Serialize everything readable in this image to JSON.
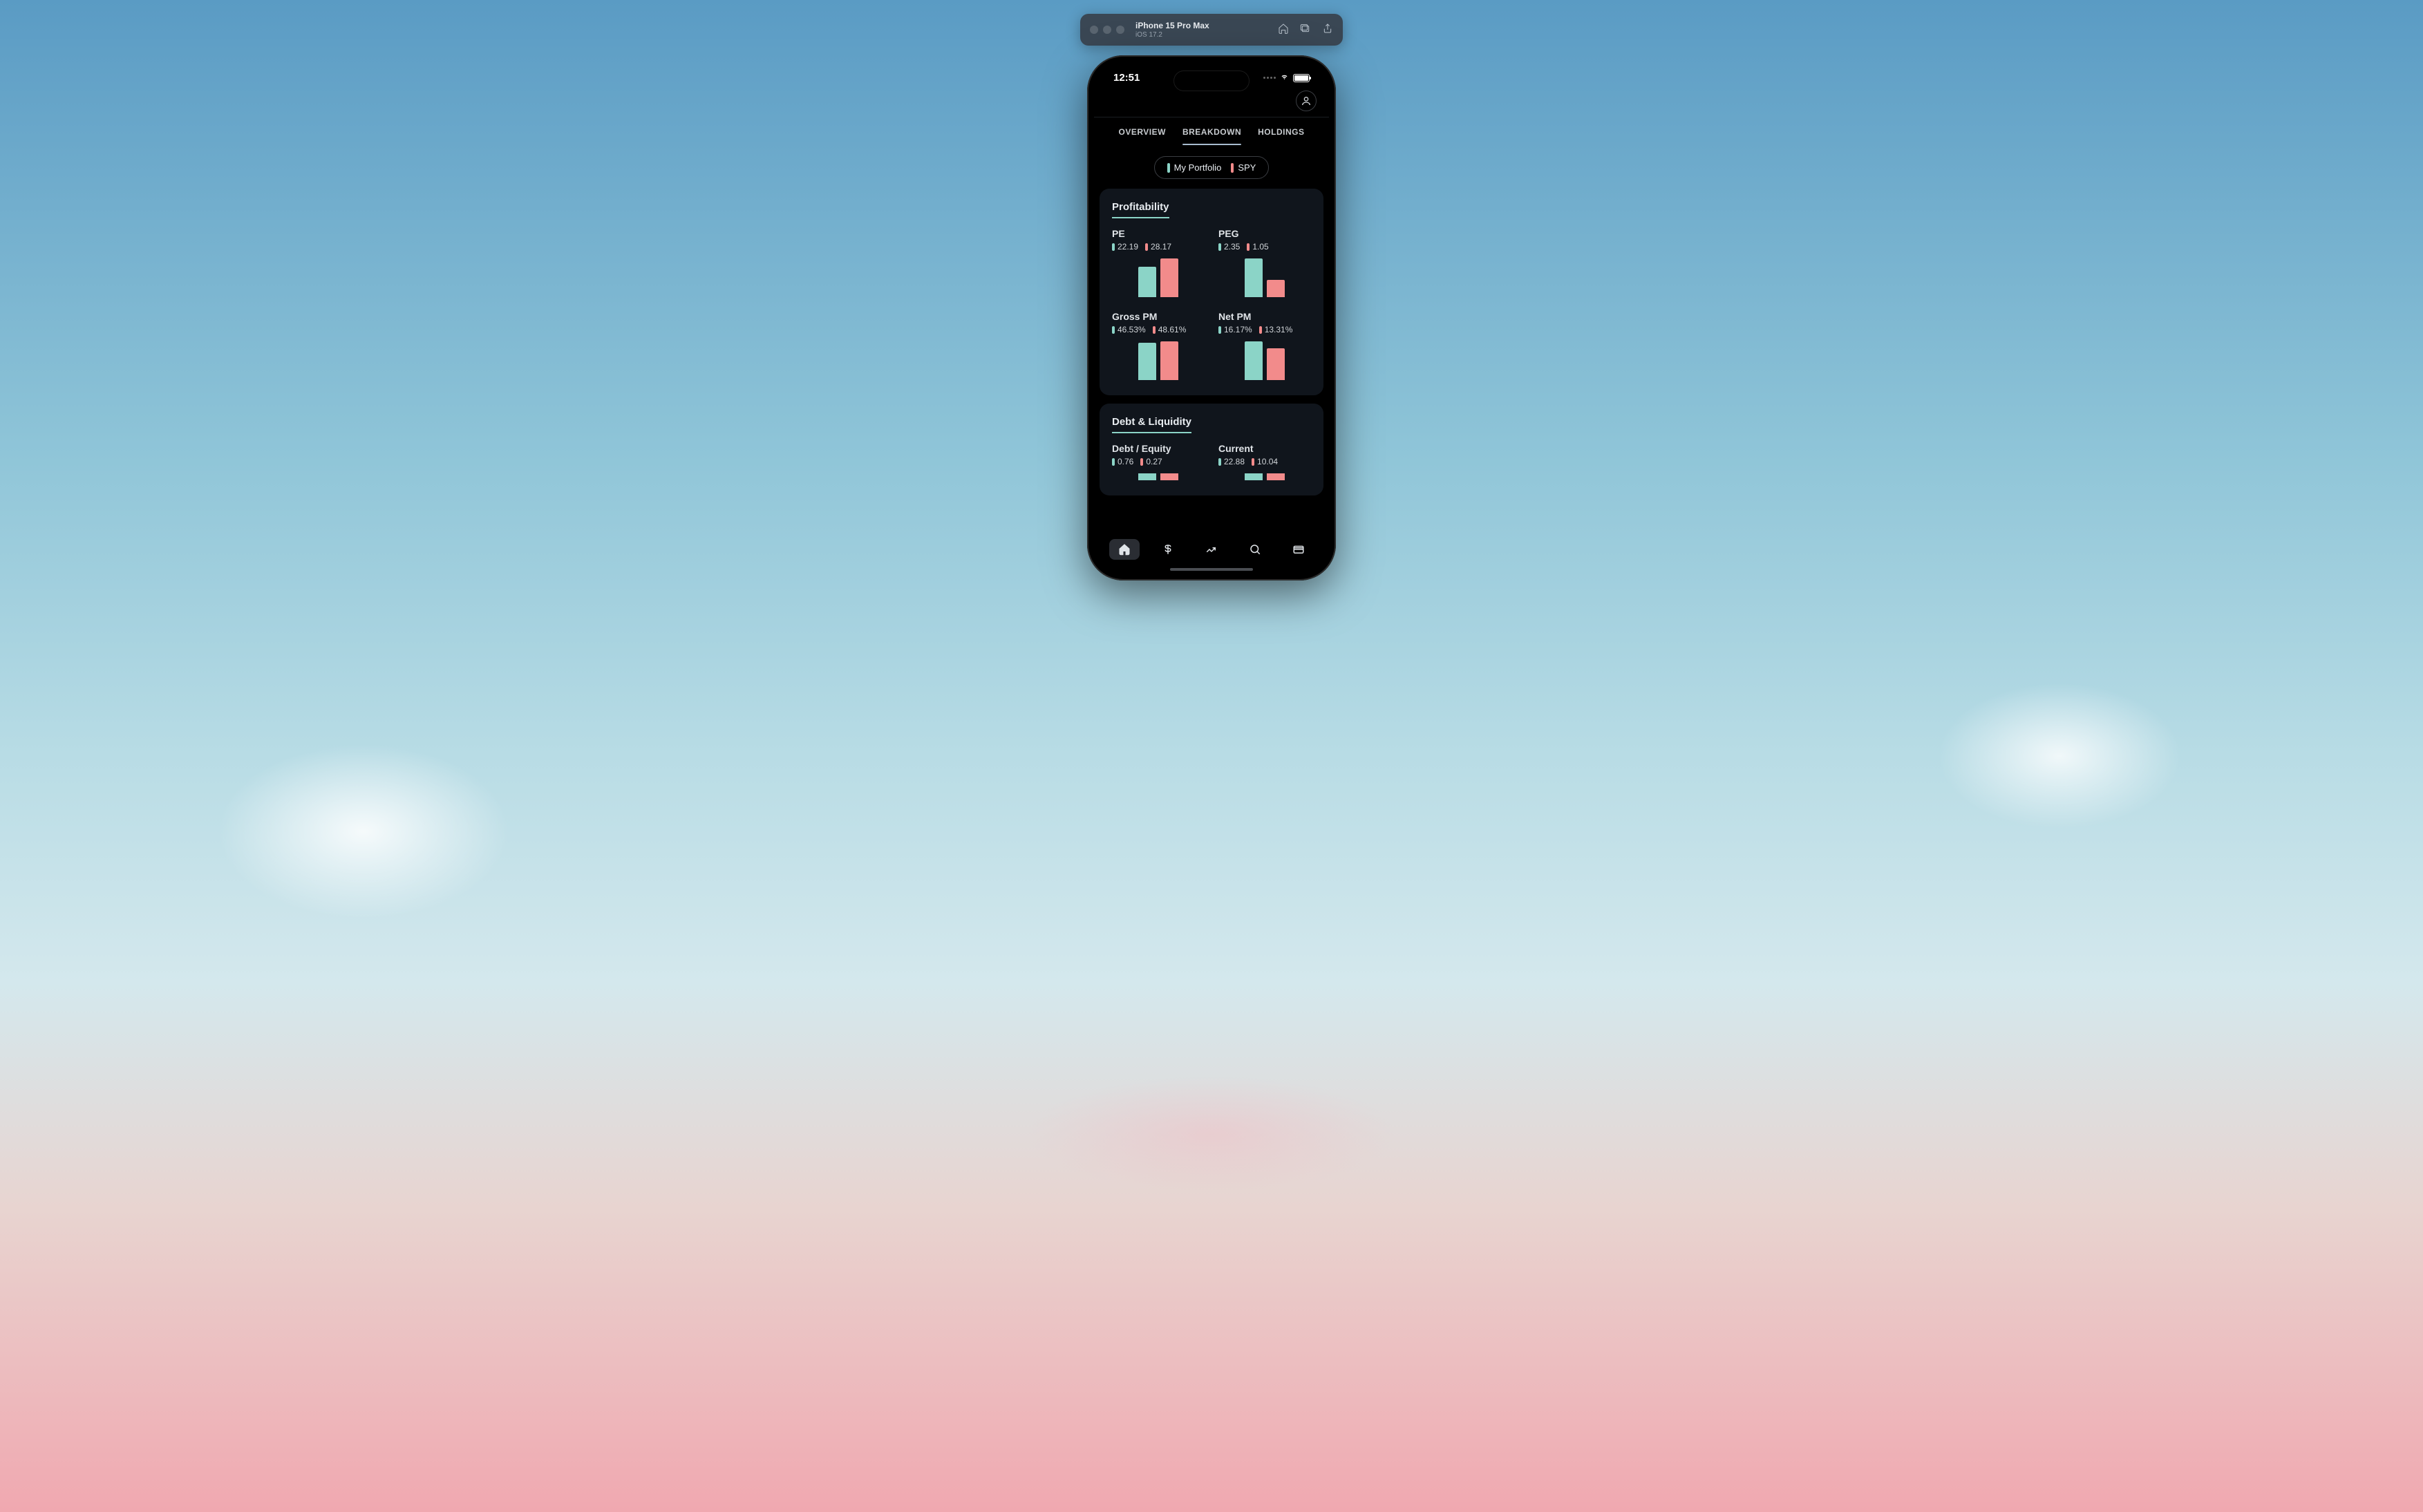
{
  "simulator": {
    "title": "iPhone 15 Pro Max",
    "subtitle": "iOS 17.2"
  },
  "status": {
    "time": "12:51"
  },
  "tabs": [
    "OVERVIEW",
    "BREAKDOWN",
    "HOLDINGS"
  ],
  "active_tab_index": 1,
  "legend": {
    "portfolio": "My Portfolio",
    "benchmark": "SPY"
  },
  "colors": {
    "teal": "#8bd4c7",
    "coral": "#f28b8b"
  },
  "sections": [
    {
      "title": "Profitability",
      "metrics": [
        {
          "name": "PE",
          "portfolio": "22.19",
          "benchmark": "28.17",
          "p_h": 44,
          "b_h": 56
        },
        {
          "name": "PEG",
          "portfolio": "2.35",
          "benchmark": "1.05",
          "p_h": 56,
          "b_h": 25
        },
        {
          "name": "Gross PM",
          "portfolio": "46.53%",
          "benchmark": "48.61%",
          "p_h": 54,
          "b_h": 56
        },
        {
          "name": "Net PM",
          "portfolio": "16.17%",
          "benchmark": "13.31%",
          "p_h": 56,
          "b_h": 46
        }
      ]
    },
    {
      "title": "Debt & Liquidity",
      "metrics": [
        {
          "name": "Debt / Equity",
          "portfolio": "0.76",
          "benchmark": "0.27",
          "p_h": 56,
          "b_h": 20
        },
        {
          "name": "Current",
          "portfolio": "22.88",
          "benchmark": "10.04",
          "p_h": 56,
          "b_h": 25
        }
      ]
    }
  ],
  "chart_data": [
    {
      "type": "bar",
      "title": "PE",
      "categories": [
        "My Portfolio",
        "SPY"
      ],
      "values": [
        22.19,
        28.17
      ]
    },
    {
      "type": "bar",
      "title": "PEG",
      "categories": [
        "My Portfolio",
        "SPY"
      ],
      "values": [
        2.35,
        1.05
      ]
    },
    {
      "type": "bar",
      "title": "Gross PM",
      "categories": [
        "My Portfolio",
        "SPY"
      ],
      "values": [
        46.53,
        48.61
      ]
    },
    {
      "type": "bar",
      "title": "Net PM",
      "categories": [
        "My Portfolio",
        "SPY"
      ],
      "values": [
        16.17,
        13.31
      ]
    },
    {
      "type": "bar",
      "title": "Debt / Equity",
      "categories": [
        "My Portfolio",
        "SPY"
      ],
      "values": [
        0.76,
        0.27
      ]
    },
    {
      "type": "bar",
      "title": "Current",
      "categories": [
        "My Portfolio",
        "SPY"
      ],
      "values": [
        22.88,
        10.04
      ]
    }
  ]
}
